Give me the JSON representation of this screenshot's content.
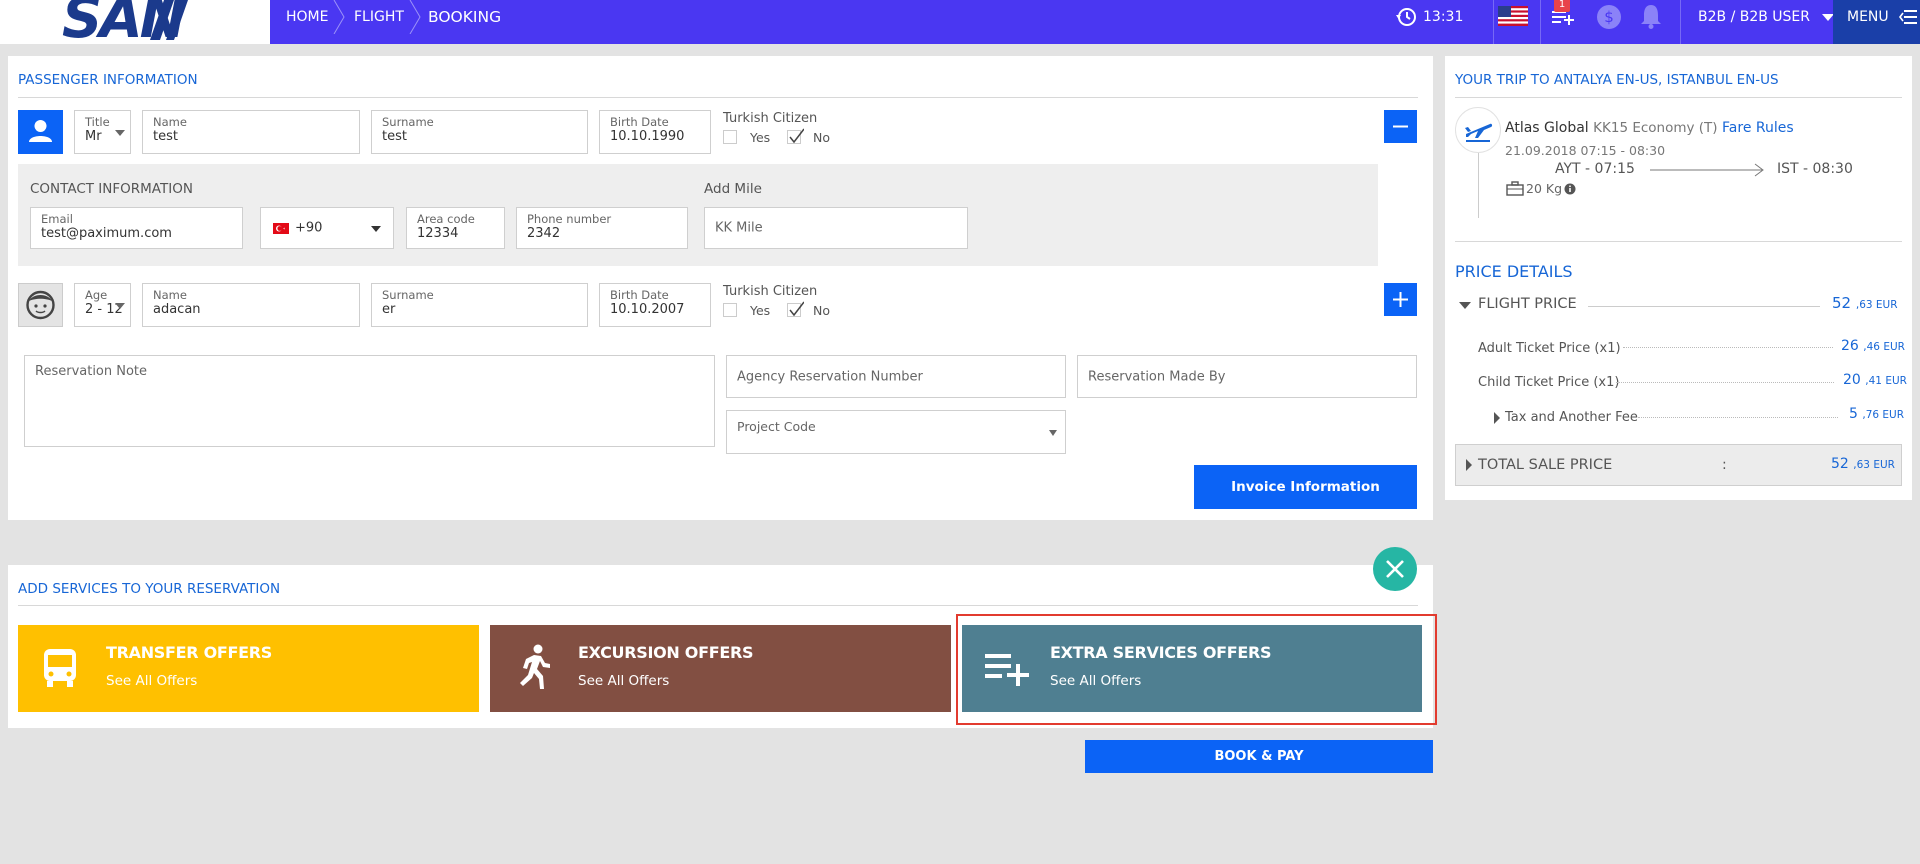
{
  "header": {
    "logo_text": "SAN",
    "breadcrumbs": [
      "HOME",
      "FLIGHT",
      "BOOKING"
    ],
    "time": "13:31",
    "cart_badge": "1",
    "user_label": "B2B / B2B USER",
    "menu_label": "MENU"
  },
  "passenger_section": {
    "title": "PASSENGER INFORMATION",
    "adult": {
      "title_label": "Title",
      "title_value": "Mr",
      "name_label": "Name",
      "name_value": "test",
      "surname_label": "Surname",
      "surname_value": "test",
      "birth_label": "Birth Date",
      "birth_value": "10.10.1990",
      "citizen_label": "Turkish Citizen",
      "yes_label": "Yes",
      "no_label": "No"
    },
    "contact": {
      "title": "CONTACT INFORMATION",
      "email_label": "Email",
      "email_value": "test@paximum.com",
      "dial_code": "+90",
      "area_label": "Area code",
      "area_value": "12334",
      "phone_label": "Phone number",
      "phone_value": "2342",
      "mile_title": "Add Mile",
      "mile_placeholder": "KK Mile"
    },
    "child": {
      "age_label": "Age",
      "age_value": "2 - 12",
      "name_label": "Name",
      "name_value": "adacan",
      "surname_label": "Surname",
      "surname_value": "er",
      "birth_label": "Birth Date",
      "birth_value": "10.10.2007",
      "citizen_label": "Turkish Citizen",
      "yes_label": "Yes",
      "no_label": "No"
    },
    "reservation_note_placeholder": "Reservation Note",
    "agency_number_placeholder": "Agency Reservation Number",
    "made_by_placeholder": "Reservation Made By",
    "project_code_placeholder": "Project Code",
    "invoice_button": "Invoice Information"
  },
  "services": {
    "title": "ADD SERVICES TO YOUR RESERVATION",
    "offers": [
      {
        "title": "TRANSFER OFFERS",
        "sub": "See All Offers",
        "color": "#ffc000"
      },
      {
        "title": "EXCURSION OFFERS",
        "sub": "See All Offers",
        "color": "#824f42"
      },
      {
        "title": "EXTRA SERVICES OFFERS",
        "sub": "See All Offers",
        "color": "#4f7f91"
      }
    ],
    "book_button": "BOOK & PAY"
  },
  "trip": {
    "title": "YOUR TRIP TO ANTALYA EN-US, ISTANBUL EN-US",
    "airline": "Atlas Global",
    "flight_info": "KK15 Economy (T)",
    "fare_rules": "Fare Rules",
    "datetime": "21.09.2018 07:15 - 08:30",
    "from": "AYT - 07:15",
    "to": "IST - 08:30",
    "baggage": "20 Kg"
  },
  "price": {
    "title": "PRICE DETAILS",
    "flight_label": "FLIGHT PRICE",
    "flight_int": "52",
    "flight_dec": ",63 EUR",
    "adult_label": "Adult Ticket Price (x1)",
    "adult_int": "26",
    "adult_dec": ",46 EUR",
    "child_label": "Child Ticket Price (x1)",
    "child_int": "20",
    "child_dec": ",41 EUR",
    "tax_label": "Tax and Another Fee",
    "tax_int": "5",
    "tax_dec": ",76 EUR",
    "total_label": "TOTAL SALE PRICE",
    "total_colon": ":",
    "total_int": "52",
    "total_dec": ",63 EUR"
  }
}
